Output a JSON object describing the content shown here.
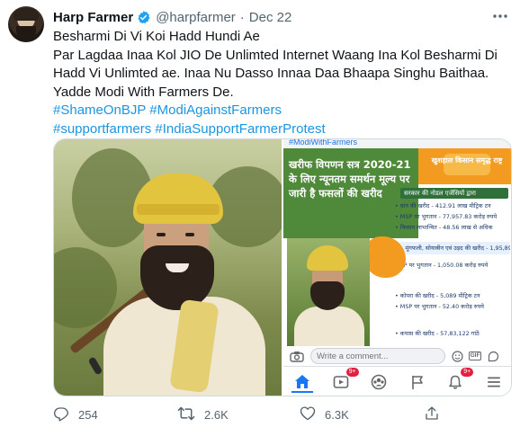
{
  "tweet": {
    "display_name": "Harp Farmer",
    "handle": "@harpfarmer",
    "separator": "·",
    "date": "Dec 22",
    "text_lines": [
      "Besharmi Di Vi Koi Hadd Hundi Ae",
      "Par Lagdaa Inaa Kol JIO De Unlimted Internet Waang Ina Kol Besharmi Di",
      "Hadd Vi Unlimted ae. Inaa Nu Dasso Innaa Daa Bhaapa Singhu Baithaa.",
      "Yadde Modi With Farmers De."
    ],
    "hashtags_line1": [
      "#ShameOnBJP",
      "#ModiAgainstFarmers"
    ],
    "hashtags_line2": [
      "#supportfarmers",
      "#IndiaSupportFarmerProtest"
    ]
  },
  "embedded_screenshot": {
    "hashtag_strip": "#ModiWithFarmers",
    "poster_title": "खरीफ विपणन सत्र 2020-21 के लिए न्यूनतम समर्थन मूल्य पर जारी है फसलों की खरीद",
    "poster_tagline": "खुशहाल किसान समृद्ध राष्ट्र",
    "stats_header": "सरकार की नोडल एजेंसियों द्वारा",
    "stats": [
      "• धान की खरीद - 412.91 लाख मीट्रिक टन",
      "• MSP पर भुगतान - 77,957.83 करोड़ रुपये",
      "• किसान लाभान्वित - 48.56 लाख से अधिक",
      "मूंग, मूंगफली, सोयाबीन एवं उड़द की खरीद - 1,95,899.38 मीट्रिक टन",
      "MSP पर भुगतान - 1,050.08 करोड़ रुपये",
      "• कोपरा की खरीद - 5,089 मीट्रिक टन",
      "• MSP पर भुगतान - 52.40 करोड़ रुपये",
      "• कपास की खरीद - 57,83,122 गांठें"
    ],
    "comment_placeholder": "Write a comment...",
    "gif_label": "GIF",
    "nav_badges": {
      "video": "9+",
      "notifications": "9+"
    }
  },
  "actions": {
    "reply_count": "254",
    "retweet_count": "2.6K",
    "like_count": "6.3K"
  },
  "colors": {
    "link": "#1b95e0",
    "verified": "#1da1f2",
    "muted": "#536471",
    "facebook_blue": "#1877f2"
  },
  "icons": [
    "verified-badge-icon",
    "more-icon",
    "camera-icon",
    "emoji-icon",
    "gif-icon",
    "sticker-icon",
    "home-icon",
    "video-icon",
    "groups-icon",
    "pages-icon",
    "notifications-icon",
    "menu-icon",
    "reply-icon",
    "retweet-icon",
    "like-icon",
    "share-icon"
  ]
}
